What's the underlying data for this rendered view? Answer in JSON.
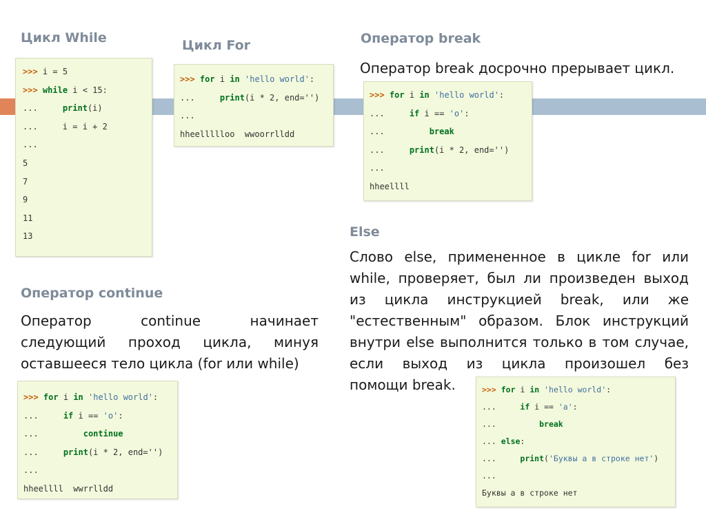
{
  "headings": {
    "while": "Цикл While",
    "for": "Цикл For",
    "break": "Оператор break",
    "continue": "Оператор continue",
    "else": "Else"
  },
  "paragraphs": {
    "break": "Оператор break досрочно прерывает цикл.",
    "continue": [
      "Оператор continue начинает",
      "следующий проход цикла, минуя",
      "оставшееся тело цикла (for или while)"
    ],
    "else": [
      "Слово else, примененное в цикле for или",
      "while, проверяет, был ли произведен выход",
      "из цикла инструкцией break, или же",
      "\"естественным\" образом. Блок инструкций",
      "внутри else выполнится только в том случае,",
      "если выход из цикла произошел без",
      "помощи break."
    ]
  },
  "code": {
    "while": {
      "lines": [
        {
          "prompt": ">>>",
          "code": "i = 5"
        },
        {
          "prompt": ">>>",
          "kw": "while",
          "code": "i < 15:"
        },
        {
          "prompt": "...",
          "code": "    print(i)"
        },
        {
          "prompt": "...",
          "code": "    i = i + 2"
        },
        {
          "prompt": "...",
          "code": ""
        },
        {
          "out": "5"
        },
        {
          "out": "7"
        },
        {
          "out": "9"
        },
        {
          "out": "11"
        },
        {
          "out": "13"
        }
      ]
    },
    "for": {
      "l1_pre": "for",
      "l1_mid": "i",
      "l1_kw": "in",
      "l1_str": "'hello world'",
      "l1_end": ":",
      "l2_fn": "print",
      "l2_args": "(i * 2, end='')",
      "l3": "...",
      "out": "hheellllloo  wwoorrlldd"
    },
    "break": {
      "l1_str": "'hello world'",
      "l2_str": "'o'",
      "l3_kw": "break",
      "l4_args": "(i * 2, end='')",
      "out": "hheellll"
    },
    "continue": {
      "l1_str": "'hello world'",
      "l2_str": "'o'",
      "l3_kw": "continue",
      "l4_args": "(i * 2, end='')",
      "out": "hheellll  wwrrlldd"
    },
    "else": {
      "l1_str": "'hello world'",
      "l2_str": "'a'",
      "l3_kw": "break",
      "l4_kw": "else",
      "l5_str": "'Буквы а в строке нет'",
      "out": "Буквы а в строке нет"
    }
  },
  "common": {
    "prompt": ">>>",
    "cont": "...",
    "kw_for": "for",
    "kw_in": "in",
    "kw_if": "if",
    "var": "i",
    "eq": "==",
    "colon": ":",
    "print": "print"
  }
}
